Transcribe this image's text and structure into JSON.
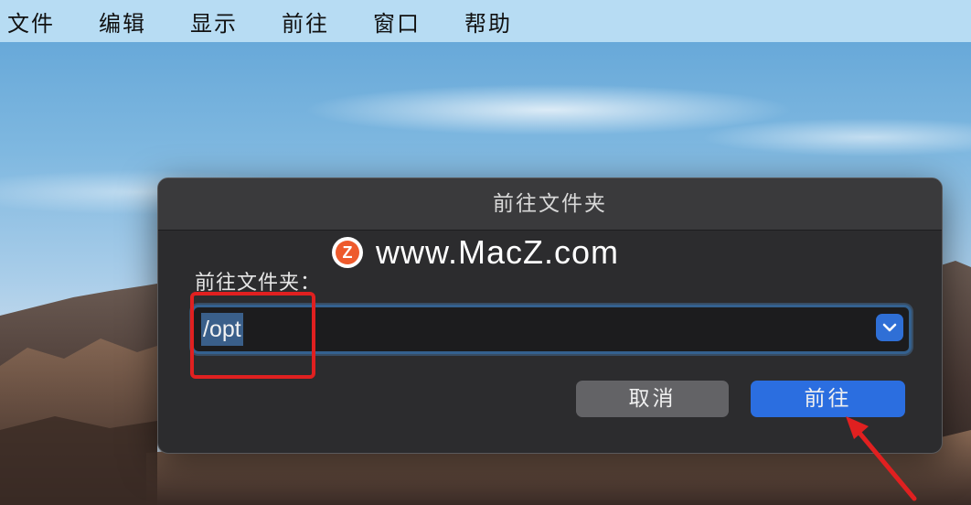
{
  "menubar": {
    "items": [
      "文件",
      "编辑",
      "显示",
      "前往",
      "窗口",
      "帮助"
    ]
  },
  "dialog": {
    "title": "前往文件夹",
    "watermark": {
      "logo_letter": "Z",
      "text": "www.MacZ.com"
    },
    "field_label": "前往文件夹：",
    "path_value": "/opt",
    "cancel_label": "取消",
    "go_label": "前往"
  },
  "colors": {
    "menubar_bg": "#b7dcf3",
    "dialog_bg": "#2c2c2e",
    "primary_button": "#2b6ee0",
    "secondary_button": "#636366",
    "annotation": "#e02020",
    "logo": "#ee5a2c"
  },
  "icons": {
    "dropdown": "chevron-down-icon",
    "annotation_arrow": "red-arrow-icon"
  }
}
